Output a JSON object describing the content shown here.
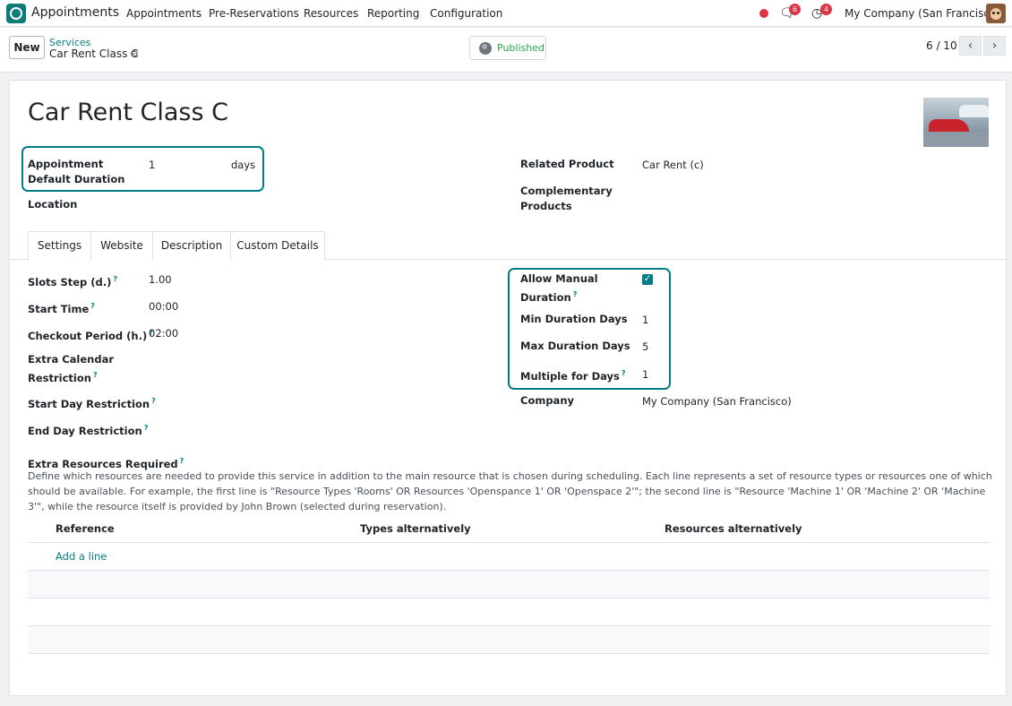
{
  "navbar": {
    "brand": "Appointments",
    "menu": [
      "Appointments",
      "Pre-Reservations",
      "Resources",
      "Reporting",
      "Configuration"
    ],
    "messages_badge": "6",
    "activities_badge": "4",
    "company": "My Company (San Francisco)"
  },
  "control": {
    "new_label": "New",
    "breadcrumb_parent": "Services",
    "breadcrumb_current": "Car Rent Class C",
    "published_label": "Published",
    "pager": "6 / 10"
  },
  "form": {
    "title": "Car Rent Class C",
    "appointment_default_duration_label": "Appointment Default Duration",
    "appointment_default_duration_value": "1",
    "appointment_default_duration_unit": "days",
    "location_label": "Location",
    "related_product_label": "Related Product",
    "related_product_value": "Car Rent (c)",
    "complementary_products_label": "Complementary Products"
  },
  "tabs": [
    "Settings",
    "Website",
    "Description",
    "Custom Details"
  ],
  "settings": {
    "slots_step_label": "Slots Step (d.)",
    "slots_step_value": "1.00",
    "start_time_label": "Start Time",
    "start_time_value": "00:00",
    "checkout_period_label": "Checkout Period (h.)",
    "checkout_period_value": "02:00",
    "extra_calendar_label": "Extra Calendar Restriction",
    "start_day_label": "Start Day Restriction",
    "end_day_label": "End Day Restriction",
    "allow_manual_label": "Allow Manual Duration",
    "allow_manual_checked": true,
    "min_duration_label": "Min Duration Days",
    "min_duration_value": "1",
    "max_duration_label": "Max Duration Days",
    "max_duration_value": "5",
    "multiple_days_label": "Multiple for Days",
    "multiple_days_value": "1",
    "company_label": "Company",
    "company_value": "My Company (San Francisco)",
    "tooltip_mark": "?"
  },
  "extra_resources": {
    "label": "Extra Resources Required",
    "description": "Define which resources are needed to provide this service in addition to the main resource that is chosen during scheduling. Each line represents a set of resource types or resources one of which should be available. For example, the first line is \"Resource Types 'Rooms' OR Resources 'Openspance 1' OR 'Openspace 2'\"; the second line is \"Resource 'Machine 1' OR 'Machine 2' OR 'Machine 3'\", while the resource itself is provided by John Brown (selected during reservation).",
    "columns": [
      "Reference",
      "Types alternatively",
      "Resources alternatively"
    ],
    "add_line": "Add a line"
  },
  "colors": {
    "accent": "#017e84",
    "danger": "#dc3545",
    "success": "#28a745"
  }
}
